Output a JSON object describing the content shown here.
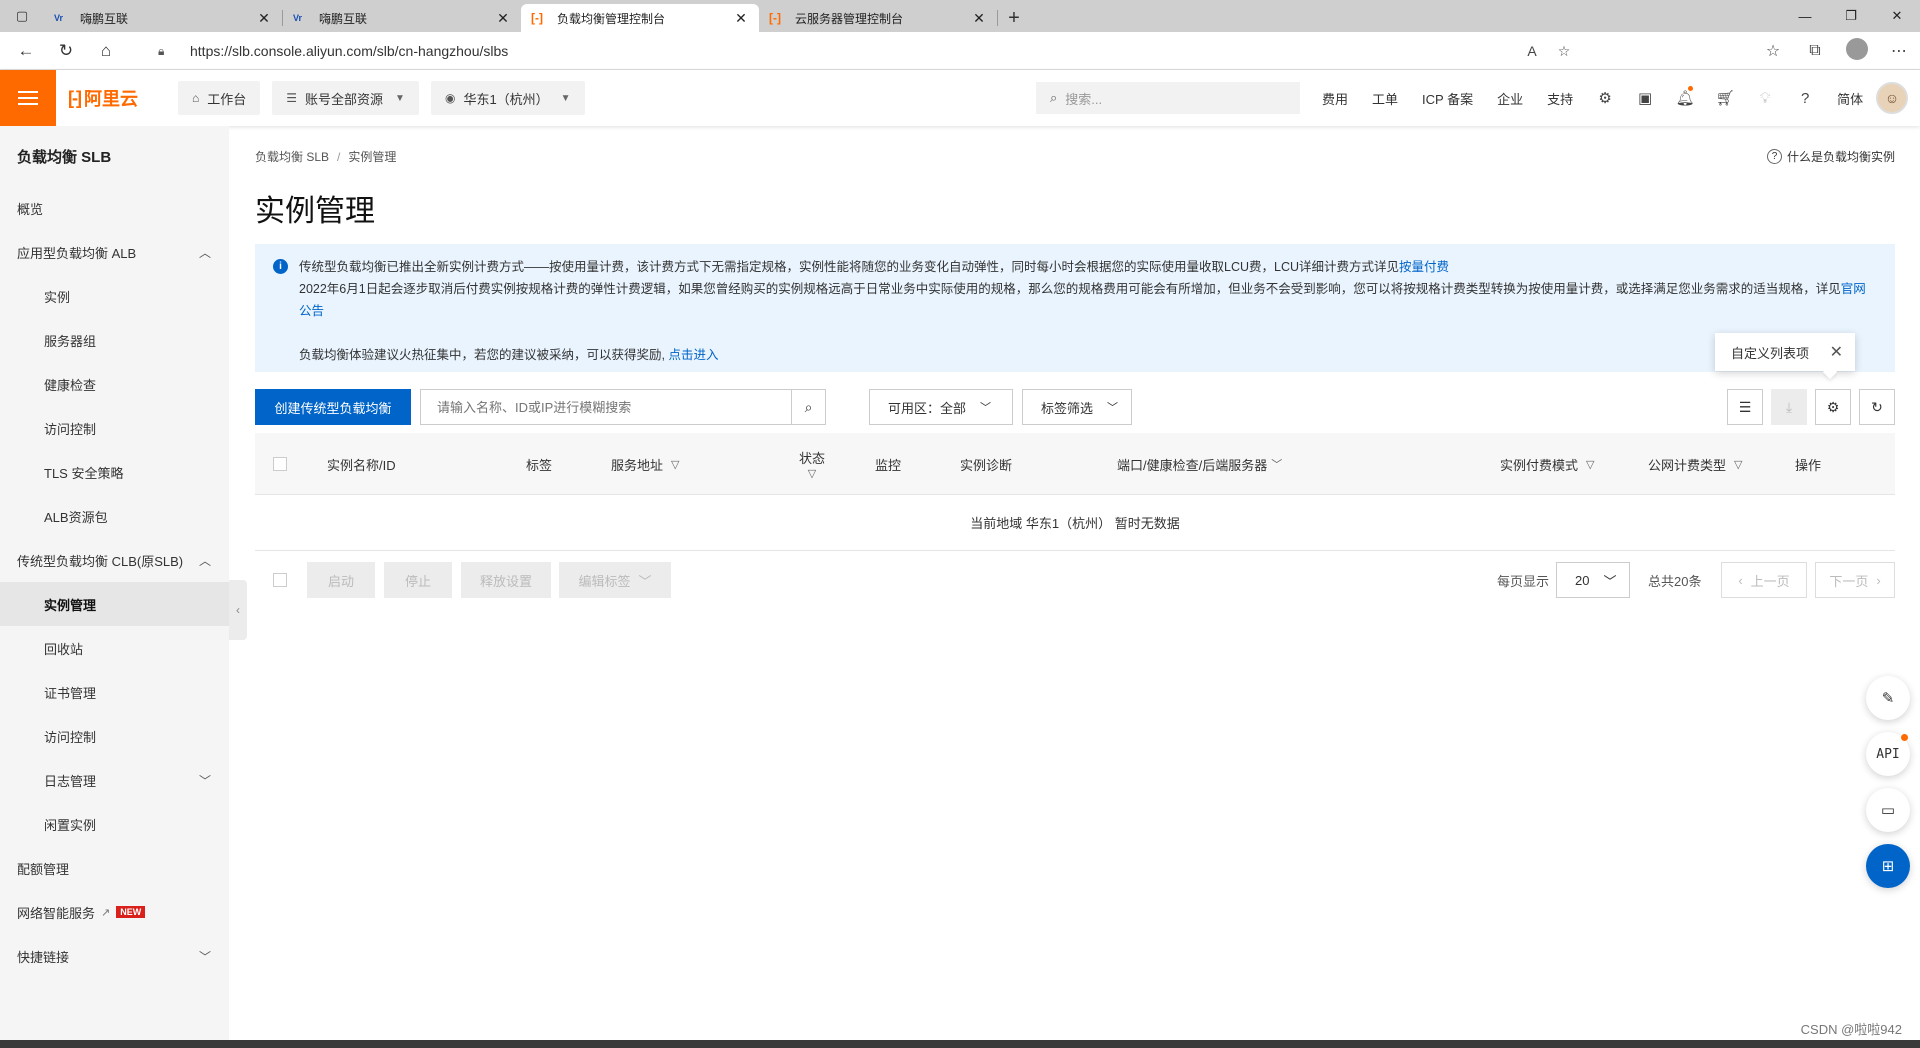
{
  "browser": {
    "tabs": [
      {
        "label": "嗨鹏互联",
        "favicon": "vr-logo",
        "active": false
      },
      {
        "label": "嗨鹏互联",
        "favicon": "vr-logo",
        "active": false
      },
      {
        "label": "负载均衡管理控制台",
        "favicon": "aliyun-logo",
        "active": true
      },
      {
        "label": "云服务器管理控制台",
        "favicon": "aliyun-logo",
        "active": false
      }
    ],
    "url": "https://slb.console.aliyun.com/slb/cn-hangzhou/slbs"
  },
  "header": {
    "logo_text": "阿里云",
    "workbench": "工作台",
    "resources": "账号全部资源",
    "region": "华东1（杭州）",
    "search_placeholder": "搜索...",
    "links": [
      "费用",
      "工单",
      "ICP 备案",
      "企业",
      "支持"
    ],
    "lang": "简体",
    "accent_color": "#ff6a00"
  },
  "sidebar": {
    "title": "负载均衡 SLB",
    "items": [
      {
        "label": "概览",
        "level": 0
      },
      {
        "label": "应用型负载均衡 ALB",
        "level": 0,
        "caret": "up"
      },
      {
        "label": "实例",
        "level": 1
      },
      {
        "label": "服务器组",
        "level": 1
      },
      {
        "label": "健康检查",
        "level": 1
      },
      {
        "label": "访问控制",
        "level": 1
      },
      {
        "label": "TLS 安全策略",
        "level": 1
      },
      {
        "label": "ALB资源包",
        "level": 1
      },
      {
        "label": "传统型负载均衡 CLB(原SLB)",
        "level": 0,
        "caret": "up"
      },
      {
        "label": "实例管理",
        "level": 1,
        "active": true
      },
      {
        "label": "回收站",
        "level": 1
      },
      {
        "label": "证书管理",
        "level": 1
      },
      {
        "label": "访问控制",
        "level": 1
      },
      {
        "label": "日志管理",
        "level": 1,
        "caret": "down"
      },
      {
        "label": "闲置实例",
        "level": 1
      },
      {
        "label": "配额管理",
        "level": 0
      },
      {
        "label": "网络智能服务",
        "level": 0,
        "external": true,
        "badge": "NEW"
      },
      {
        "label": "快捷链接",
        "level": 0,
        "caret": "down"
      }
    ]
  },
  "main": {
    "breadcrumb": [
      "负载均衡 SLB",
      "实例管理"
    ],
    "help_link": "什么是负载均衡实例",
    "title": "实例管理",
    "notice": {
      "line1": "传统型负载均衡已推出全新实例计费方式——按使用量计费，该计费方式下无需指定规格，实例性能将随您的业务变化自动弹性，同时每小时会根据您的实际使用量收取LCU费，LCU详细计费方式详见",
      "line1_link": "按量付费",
      "line2": "2022年6月1日起会逐步取消后付费实例按规格计费的弹性计费逻辑，如果您曾经购买的实例规格远高于日常业务中实际使用的规格，那么您的规格费用可能会有所增加，但业务不会受到影响，您可以将按规格计费类型转换为按使用量计费，或选择满足您业务需求的适当规格，详见",
      "line2_link": "官网公告",
      "line3": "负载均衡体验建议火热征集中，若您的建议被采纳，可以获得奖励, ",
      "line3_link": "点击进入"
    },
    "column_tip": "自定义列表项",
    "toolbar": {
      "create_button": "创建传统型负载均衡",
      "search_placeholder": "请输入名称、ID或IP进行模糊搜索",
      "zone_label": "可用区：全部",
      "tag_filter": "标签筛选"
    },
    "table": {
      "columns": [
        "实例名称/ID",
        "标签",
        "服务地址",
        "状态",
        "监控",
        "实例诊断",
        "端口/健康检查/后端服务器",
        "实例付费模式",
        "公网计费类型",
        "操作"
      ],
      "empty_text": "当前地域 华东1（杭州） 暂时无数据"
    },
    "footer": {
      "buttons": [
        "启动",
        "停止",
        "释放设置",
        "编辑标签"
      ],
      "per_page_label": "每页显示",
      "per_page_value": "20",
      "total": "总共20条",
      "prev": "上一页",
      "next": "下一页"
    }
  },
  "watermark": "CSDN @啦啦942"
}
